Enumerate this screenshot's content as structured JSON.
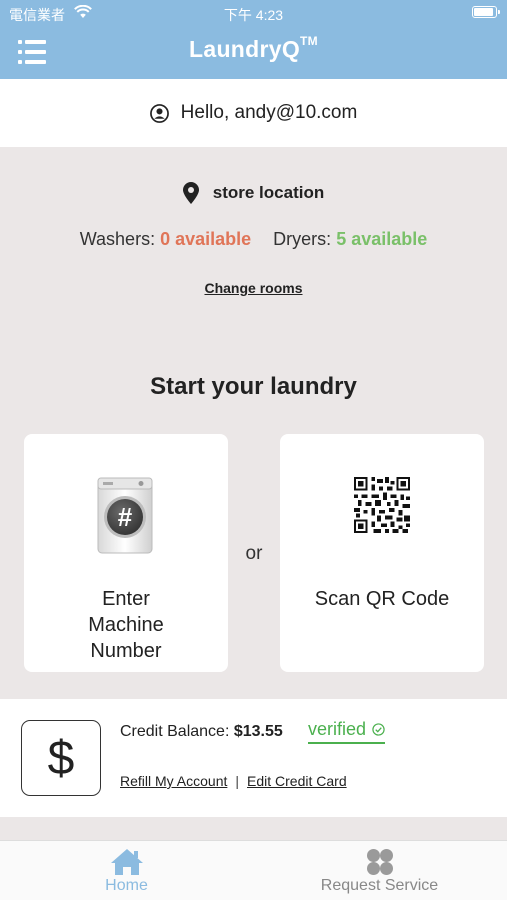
{
  "status_bar": {
    "carrier": "電信業者",
    "time": "下午 4:23"
  },
  "header": {
    "title": "LaundryQ",
    "trademark": "TM"
  },
  "greeting": {
    "text": "Hello, andy@10.com"
  },
  "location": {
    "name": "store location",
    "washers_label": "Washers:",
    "washers_value": "0 available",
    "dryers_label": "Dryers:",
    "dryers_value": "5 available",
    "change_rooms": "Change rooms"
  },
  "start": {
    "heading": "Start your laundry",
    "enter_machine_label": "Enter Machine Number",
    "or": "or",
    "scan_qr_label": "Scan QR Code",
    "machine_symbol": "#"
  },
  "credit": {
    "symbol": "$",
    "balance_label": "Credit Balance:",
    "balance_value": "$13.55",
    "verified": "verified",
    "refill": "Refill My Account",
    "separator": "|",
    "edit_card": "Edit Credit Card"
  },
  "tabbar": {
    "home": "Home",
    "request_service": "Request Service",
    "active": "home"
  },
  "colors": {
    "header": "#8bbbe0",
    "washers_available": "#e07558",
    "dryers_available": "#7ac069",
    "verified": "#4bb04e"
  }
}
